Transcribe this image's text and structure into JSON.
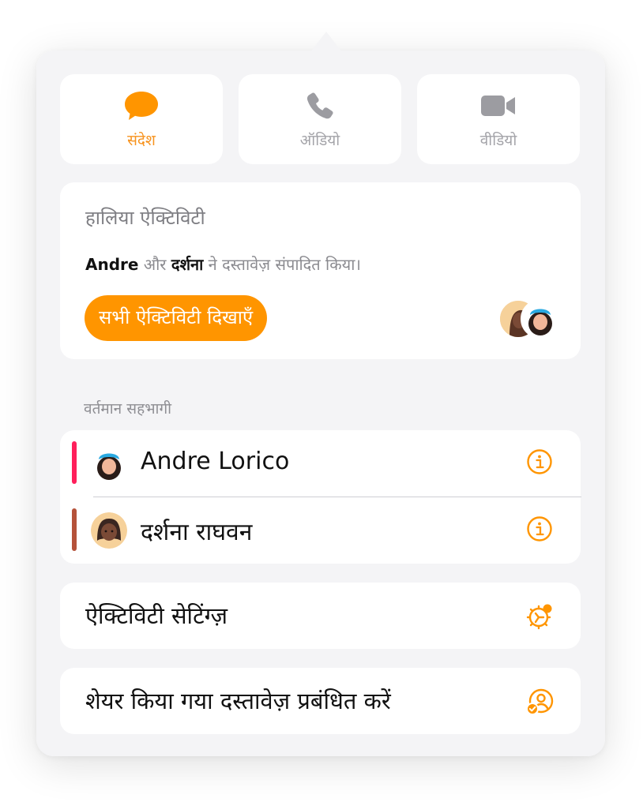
{
  "tiles": [
    {
      "label": "संदेश",
      "icon": "message-bubble-icon",
      "active": true
    },
    {
      "label": "ऑडियो",
      "icon": "phone-icon",
      "active": false
    },
    {
      "label": "वीडियो",
      "icon": "video-camera-icon",
      "active": false
    }
  ],
  "activity": {
    "title": "हालिया ऐक्टिविटी",
    "user1": "Andre",
    "conj": " और ",
    "user2": "दर्शना",
    "rest": " ने दस्तावेज़ संपादित किया।",
    "button_label": "सभी ऐक्टिविटी दिखाएँ"
  },
  "participants": {
    "header": "वर्तमान सहभागी",
    "items": [
      {
        "name": "Andre Lorico",
        "color": "#ff1f5b",
        "avatar": "memoji-curly-hair-beanie"
      },
      {
        "name": "दर्शना राघवन",
        "color": "#b5523a",
        "avatar": "memoji-dark-hair"
      }
    ]
  },
  "settings": {
    "activity_settings_label": "ऐक्टिविटी सेटिंग्ज़",
    "manage_label": "शेयर किया गया दस्तावेज़ प्रबंधित करें"
  },
  "colors": {
    "accent": "#ff9500",
    "background": "#f4f4f6",
    "card": "#ffffff"
  }
}
